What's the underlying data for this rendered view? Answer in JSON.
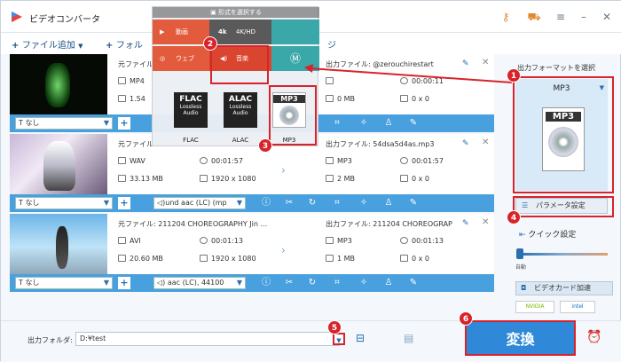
{
  "app": {
    "title": "ビデオコンバータ"
  },
  "toolbar": {
    "add_files": "ファイル追加",
    "add_folder": "フォル",
    "merge_partial": "ジ"
  },
  "popup": {
    "header": "形式を選択する",
    "categories": {
      "video": "動画",
      "hd": "4K/HD",
      "web": "ウェブ",
      "audio": "音楽"
    },
    "formats": [
      {
        "code": "FLAC",
        "sub1": "Lossless",
        "sub2": "Audio",
        "label": "FLAC"
      },
      {
        "code": "ALAC",
        "sub1": "Lossless",
        "sub2": "Audio",
        "label": "ALAC"
      },
      {
        "code": "MP3",
        "label": "MP3"
      }
    ]
  },
  "rows": [
    {
      "src_prefix": "元ファイル",
      "format": "MP4",
      "size_partial": "1.54",
      "out_label": "出力ファイル:",
      "out_name": "@zerouchirestart",
      "out_format_icon": "mp3",
      "out_size": "0 MB",
      "out_dur": "00:00:11",
      "out_res": "0 x 0",
      "subtitle": "なし"
    },
    {
      "src_prefix": "元ファイル",
      "format": "WAV",
      "duration": "00:01:57",
      "size": "33.13 MB",
      "res": "1920 x 1080",
      "out_label": "出力ファイル:",
      "out_name": "54dsa5d4as.mp3",
      "out_format": "MP3",
      "out_dur": "00:01:57",
      "out_size": "2 MB",
      "out_res": "0 x 0",
      "subtitle": "なし",
      "audio": "und aac (LC) (mp"
    },
    {
      "src_label": "元ファイル:",
      "src_name": "211204 CHOREOGRAPHY Jin ...",
      "format": "AVI",
      "duration": "00:01:13",
      "size": "20.60 MB",
      "res": "1920 x 1080",
      "out_label": "出力ファイル:",
      "out_name": "211204 CHOREOGRAP",
      "out_format": "MP3",
      "out_dur": "00:01:13",
      "out_size": "1 MB",
      "out_res": "0 x 0",
      "subtitle": "なし",
      "audio": "aac (LC), 44100"
    }
  ],
  "right_panel": {
    "output_format_label": "出力フォーマットを選択",
    "format": "MP3",
    "params_button": "パラメータ設定",
    "quick_settings": "クイック設定",
    "slider_label": "自動",
    "gpu_accel": "ビデオカード加速",
    "gpu_vendor1": "NVIDIA",
    "gpu_vendor2": "intel"
  },
  "bottom": {
    "output_folder_label": "出力フォルダ:",
    "output_folder_value": "D:¥test",
    "convert_button": "変換"
  },
  "callouts": [
    "1",
    "2",
    "3",
    "4",
    "5",
    "6"
  ],
  "colors": {
    "accent": "#49a0de",
    "callout": "#d8232a",
    "convert": "#2f88d8"
  }
}
